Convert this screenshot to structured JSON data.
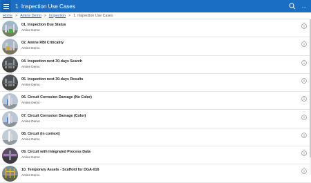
{
  "app": {
    "title": "1. Inspection Use Cases",
    "more_label": "..."
  },
  "breadcrumb": {
    "items": [
      "Home",
      "Amine Demo",
      "Inspection"
    ],
    "separator": ">",
    "current": "1. Inspection Use Cases"
  },
  "items": [
    {
      "title": "01. Inspection Due Status",
      "subtitle": "Amine Demo",
      "thumb": "plant-green"
    },
    {
      "title": "02. Amine RBI Criticality",
      "subtitle": "Amine Demo",
      "thumb": "plant-orange"
    },
    {
      "title": "04. Inspection next 30-days Search",
      "subtitle": "Amine Demo",
      "thumb": "plant-night"
    },
    {
      "title": "05. Inspection  next 30-days Results",
      "subtitle": "Amine Demo",
      "thumb": "plant-night"
    },
    {
      "title": "06. Circuit Corrosion Damage (No Color)",
      "subtitle": "Amine Demo",
      "thumb": "tower-blue"
    },
    {
      "title": "07. Circuit Corrosion Damage (Color)",
      "subtitle": "Amine Demo",
      "thumb": "tower-blue"
    },
    {
      "title": "08. Circuit (in context)",
      "subtitle": "Amine Demo",
      "thumb": "tower-gray"
    },
    {
      "title": "09. Circuit with Integrated Process Data",
      "subtitle": "Amine Demo",
      "thumb": "pipe-purple"
    },
    {
      "title": "10. Temporary Assets - Scaffold for DGA-016",
      "subtitle": "Amine Demo",
      "thumb": "scaffold"
    }
  ],
  "colors": {
    "accent": "#1a6fc4",
    "link": "#1a6fc4"
  },
  "icons": {
    "menu": "hamburger-icon",
    "search": "search-icon",
    "info": "info-icon"
  }
}
